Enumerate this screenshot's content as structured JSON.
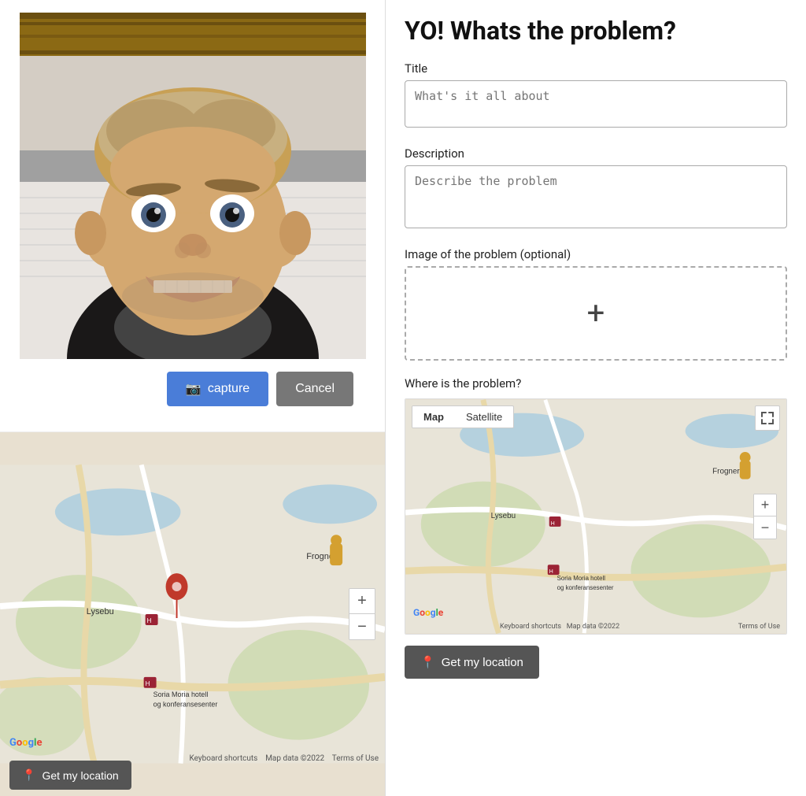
{
  "app": {
    "title": "YO! Whats the problem?"
  },
  "form": {
    "title_label": "Title",
    "title_placeholder": "What's it all about",
    "desc_label": "Description",
    "desc_placeholder": "Describe the problem",
    "image_label": "Image of the problem (optional)",
    "image_plus": "+",
    "where_label": "Where is the problem?",
    "map_tab_map": "Map",
    "map_tab_satellite": "Satellite",
    "get_location_btn": "Get my location",
    "get_location_btn_left": "Get my location"
  },
  "camera": {
    "capture_btn": "capture",
    "cancel_btn": "Cancel"
  },
  "map": {
    "google_label": "Google",
    "keyboard_shortcuts": "Keyboard shortcuts",
    "map_data": "Map data ©2022",
    "terms": "Terms of Use",
    "lysebu_label": "Lysebu",
    "frogners_label": "Frogners",
    "soria_moria_label": "Soria Moria hotell og konferansesenter",
    "zoom_in": "+",
    "zoom_out": "−"
  },
  "icons": {
    "camera": "📷",
    "location_pin": "📍"
  }
}
